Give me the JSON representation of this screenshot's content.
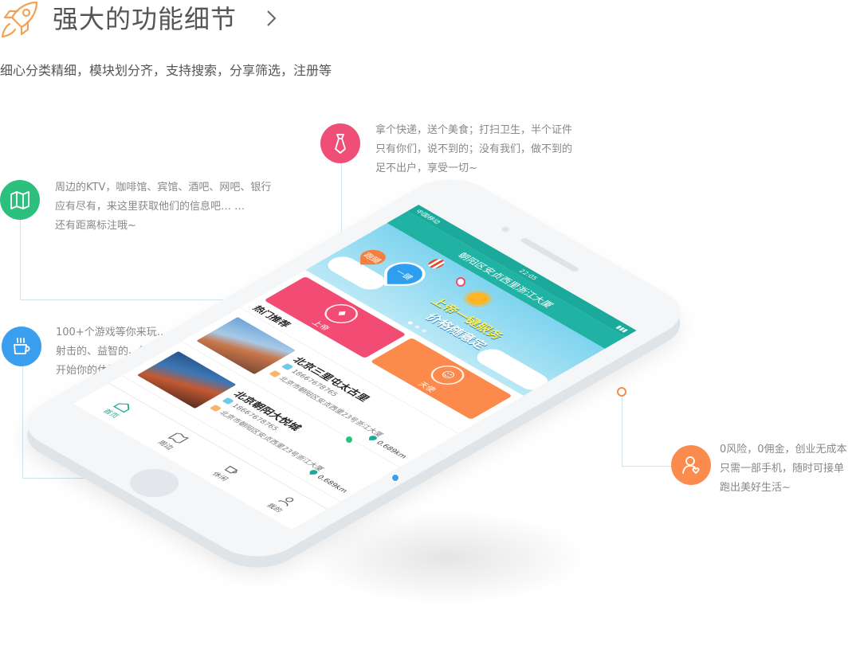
{
  "header": {
    "title": "强大的功能细节",
    "subtitle": "细心分类精细，模块划分齐，支持搜索，分享筛选，注册等"
  },
  "features": {
    "nearby": {
      "lines": [
        "周边的KTV，咖啡馆、宾馆、酒吧、网吧、银行",
        "应有尽有，来这里获取他们的信息吧… …",
        "还有距离标注哦~"
      ],
      "color": "#2dbf7e",
      "icon": "map-icon"
    },
    "errand": {
      "lines": [
        "拿个快递，送个美食；打扫卫生，半个证件",
        "只有你们，说不到的；没有我们，做不到的",
        "足不出户，享受一切~"
      ],
      "color": "#ef4f77",
      "icon": "tie-icon"
    },
    "leisure": {
      "lines": [
        "100+个游戏等你来玩… …",
        "射击的、益智的、格斗的、塔防的、冒险的等等等",
        "开始你的休闲之旅吧~"
      ],
      "color": "#3b9ff0",
      "icon": "coffee-icon"
    },
    "courier": {
      "lines": [
        "0风险，0佣金，创业无成本",
        "只需一部手机，随时可接单",
        "跑出美好生活~"
      ],
      "color": "#fb8c4e",
      "icon": "user-icon"
    }
  },
  "app": {
    "status_carrier": "中国移动",
    "status_time": "22:05",
    "title": "朝阳区安贞西里浙江大厦",
    "banner": {
      "slogan_line1": "上帝一键服务",
      "slogan_line2": "价格随意定",
      "pin_left_label": "跑腿",
      "pin_center_label": "一键"
    },
    "tiles": {
      "god_label": "上帝",
      "angel_label": "天使",
      "god_color": "#f24b74",
      "angel_color": "#fc8a4c"
    },
    "section_title": "热门推荐",
    "list": [
      {
        "name": "北京三里屯太古里",
        "phone": "18667678765",
        "address": "北京市朝阳区安贞西里23号浙江大厦",
        "distance": "0.689km"
      },
      {
        "name": "北京朝阳大悦城",
        "phone": "18667678765",
        "address": "北京市朝阳区安贞西里23号浙江大厦",
        "distance": "0.689km"
      }
    ],
    "tabs": {
      "home": "首页",
      "nearby": "周边",
      "leisure": "休闲",
      "mine": "我的"
    },
    "accent": "#1aa99a"
  }
}
